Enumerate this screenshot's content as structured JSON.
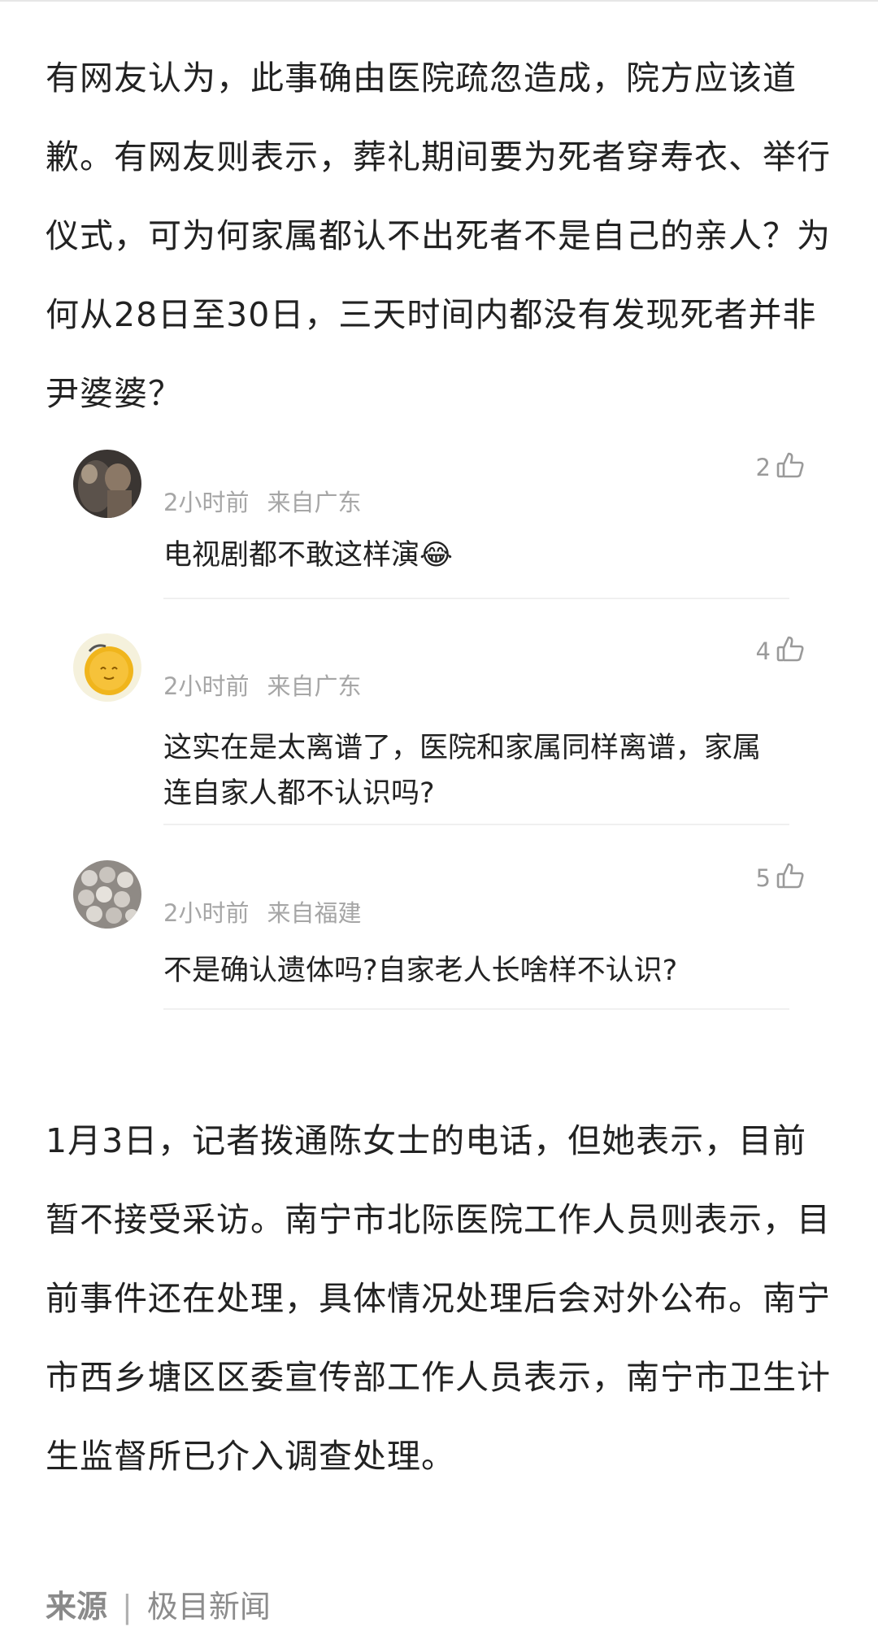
{
  "article": {
    "paragraph_1": "有网友认为，此事确由医院疏忽造成，院方应该道歉。有网友则表示，葬礼期间要为死者穿寿衣、举行仪式，可为何家属都认不出死者不是自己的亲人？为何从28日至30日，三天时间内都没有发现死者并非尹婆婆？",
    "paragraph_2": "1月3日，记者拨通陈女士的电话，但她表示，目前暂不接受采访。南宁市北际医院工作人员则表示，目前事件还在处理，具体情况处理后会对外公布。南宁市西乡塘区区委宣传部工作人员表示，南宁市卫生计生监督所已介入调查处理。"
  },
  "comments": [
    {
      "time": "2小时前",
      "location": "来自广东",
      "likes": "2",
      "text": "电视剧都不敢这样演😂"
    },
    {
      "time": "2小时前",
      "location": "来自广东",
      "likes": "4",
      "text": "这实在是太离谱了，医院和家属同样离谱，家属连自家人都不认识吗?"
    },
    {
      "time": "2小时前",
      "location": "来自福建",
      "likes": "5",
      "text": "不是确认遗体吗?自家老人长啥样不认识?"
    }
  ],
  "source": {
    "label": "来源",
    "separator": "|",
    "value": "极目新闻"
  },
  "icons": {
    "like": "thumbs-up-outline-icon"
  },
  "colors": {
    "text": "#222222",
    "meta": "#a6a6a6",
    "divider": "#f0f0f0"
  }
}
